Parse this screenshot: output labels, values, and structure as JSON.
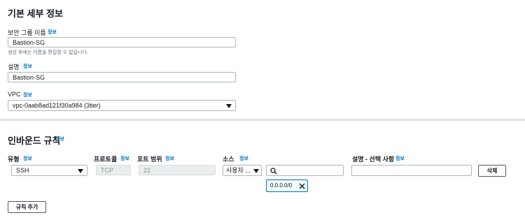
{
  "basic": {
    "title": "기본 세부 정보",
    "info": "정보",
    "sg_name": {
      "label": "보안 그룹 이름",
      "value": "Bastion-SG",
      "hint": "생성 후에는 이름을 편집할 수 없습니다."
    },
    "description": {
      "label": "설명",
      "value": "Bastion-SG"
    },
    "vpc": {
      "label": "VPC",
      "value": "vpc-0aab8ad121f30a984 (3tier)"
    }
  },
  "inbound": {
    "title": "인바운드 규칙",
    "info": "정보",
    "headers": {
      "type": "유형",
      "protocol": "프로토콜",
      "port_range": "포트 범위",
      "source": "소스",
      "description": "설명 - 선택 사항"
    },
    "rule": {
      "type": "SSH",
      "protocol": "TCP",
      "port_range": "22",
      "source_type": "사용자 ...",
      "source_search": "",
      "source_token": "0.0.0.0/0",
      "description": "",
      "delete_label": "삭제"
    },
    "add_rule_label": "규칙 추가"
  },
  "icons": {
    "dropdown": "caret-down-icon",
    "search": "search-icon",
    "remove": "close-icon"
  }
}
